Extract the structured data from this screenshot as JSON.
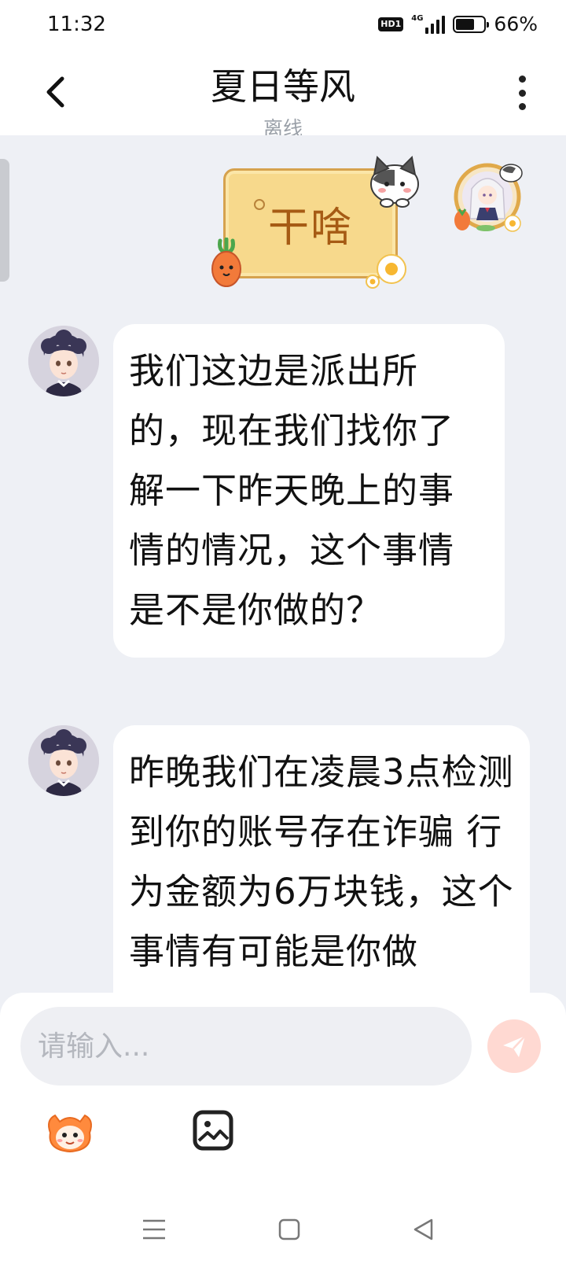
{
  "status_bar": {
    "time": "11:32",
    "hd_badge": "HD1",
    "network": "4G",
    "battery_percent": "66%",
    "battery_level": 0.66
  },
  "header": {
    "title": "夏日等风",
    "subtitle": "离线",
    "back_icon": "chevron-left-icon",
    "more_icon": "more-vertical-icon"
  },
  "messages": [
    {
      "direction": "outgoing",
      "type": "sticker",
      "sticker_text": "干啥"
    },
    {
      "direction": "incoming",
      "type": "text",
      "text": "我们这边是派出所的，现在我们找你了解一下昨天晚上的事情的情况，这个事情是不是你做的？"
    },
    {
      "direction": "incoming",
      "type": "text",
      "text": "昨晚我们在凌晨3点检测到你的账号存在诈骗  行为金额为6万块钱，这个事情有可能是你做"
    }
  ],
  "composer": {
    "placeholder": "请输入...",
    "send_icon": "send-icon",
    "emoji_icon": "emoji-icon",
    "image_icon": "image-icon"
  },
  "nav": {
    "menu_icon": "menu-icon",
    "home_icon": "home-icon",
    "back_icon": "back-triangle-icon"
  },
  "colors": {
    "background": "#eef0f5",
    "bubble": "#ffffff",
    "sticker_board": "#f7d98c",
    "sticker_text": "#a65b14",
    "send_button": "#ffd9d2"
  }
}
